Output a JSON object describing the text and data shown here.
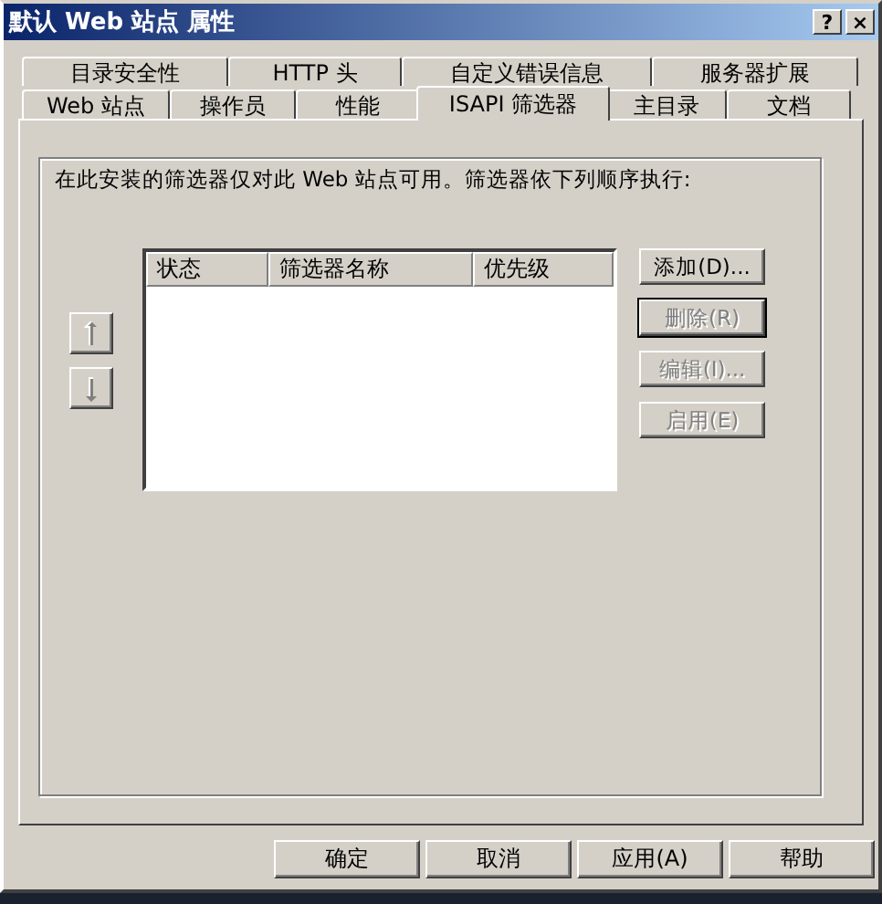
{
  "window": {
    "title": "默认 Web 站点 属性",
    "controls": [
      {
        "label": "?"
      },
      {
        "label": "×"
      }
    ]
  },
  "tabs": [
    [
      {
        "label": "目录安全性",
        "selected": false
      },
      {
        "label": "HTTP 头",
        "selected": false
      },
      {
        "label": "自定义错误信息",
        "selected": false
      },
      {
        "label": "服务器扩展",
        "selected": false
      }
    ],
    [
      {
        "label": "Web 站点",
        "selected": false
      },
      {
        "label": "操作员",
        "selected": false
      },
      {
        "label": "性能",
        "selected": false
      },
      {
        "label": "ISAPI 筛选器",
        "selected": true
      },
      {
        "label": "主目录",
        "selected": false
      },
      {
        "label": "文档",
        "selected": false
      }
    ]
  ],
  "description": "在此安装的筛选器仅对此 Web 站点可用。筛选器依下列顺序执行:",
  "table": {
    "columns": [
      "状态",
      "筛选器名称",
      "优先级"
    ]
  },
  "side_buttons": [
    {
      "label": "添加(D)...",
      "disabled": false,
      "default": false
    },
    {
      "label": "删除(R)",
      "disabled": true,
      "default": true
    },
    {
      "label": "编辑(I)...",
      "disabled": true,
      "default": false
    },
    {
      "label": "启用(E)",
      "disabled": true,
      "default": false
    }
  ],
  "buttons": [
    {
      "label": "确定"
    },
    {
      "label": "取消"
    },
    {
      "label": "应用(A)"
    },
    {
      "label": "帮助"
    }
  ]
}
